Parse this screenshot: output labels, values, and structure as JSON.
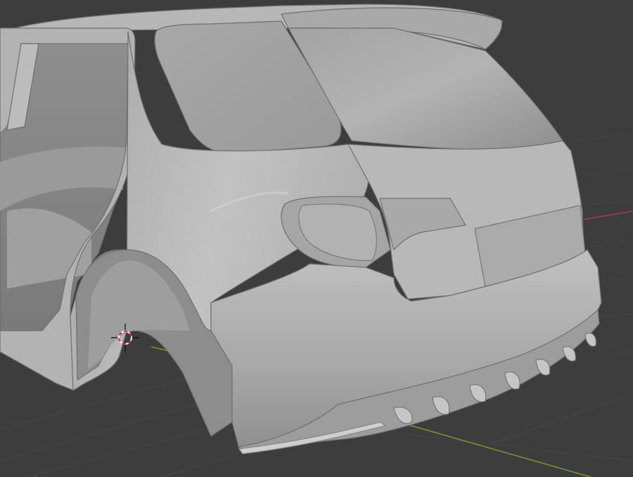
{
  "app": "3D viewport",
  "viewport": {
    "background": "#3d3d3d",
    "grid_color": "#474747",
    "x_axis_color": "#a53d49",
    "y_axis_color": "#6f9b32",
    "cursor_color": "#d23434"
  },
  "model": {
    "type": "car-body",
    "material_color": "#b9b9b9",
    "shadow_color": "#7f7f7f",
    "highlight_color": "#d2d2d2"
  }
}
